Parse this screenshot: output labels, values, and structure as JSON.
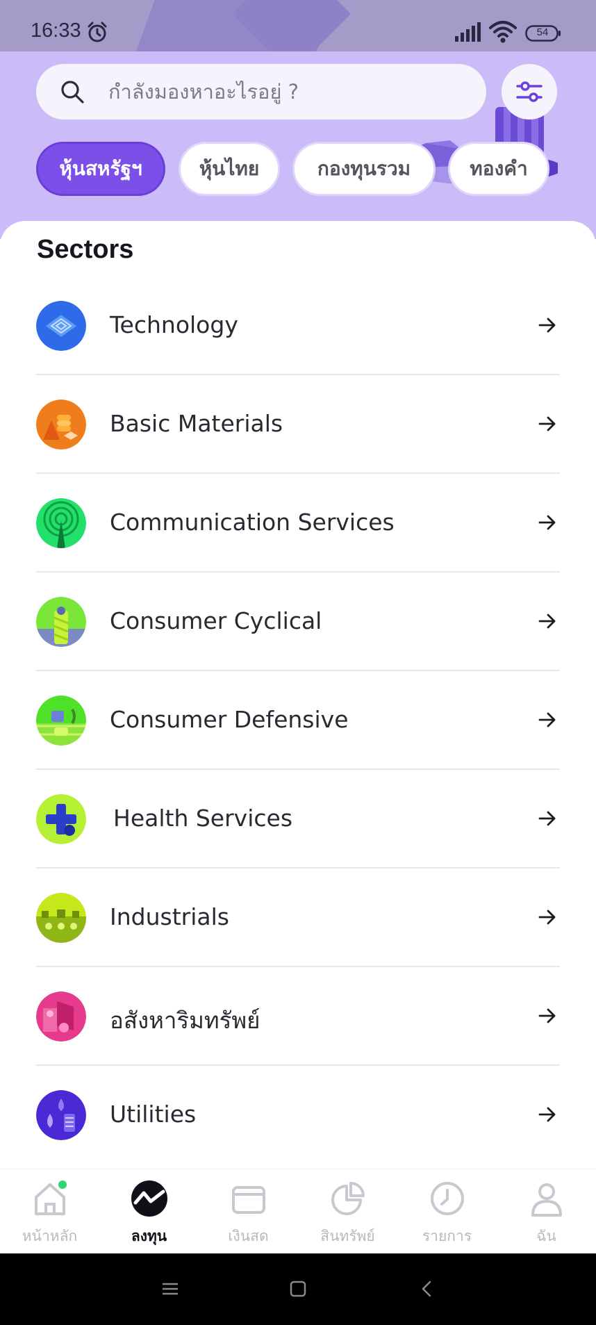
{
  "status_bar": {
    "time": "16:33",
    "battery": "54",
    "icons": [
      "alarm-icon",
      "signal-icon",
      "wifi-icon",
      "battery-icon"
    ]
  },
  "search": {
    "placeholder": "กำลังมองหาอะไรอยู่ ?",
    "icon": "search-icon",
    "filter_icon": "filter-sliders-icon"
  },
  "tabs": [
    {
      "label": "หุ้นสหรัฐฯ",
      "active": true
    },
    {
      "label": "หุ้นไทย",
      "active": false
    },
    {
      "label": "กองทุนรวม",
      "active": false
    },
    {
      "label": "ทองคำ",
      "active": false
    }
  ],
  "sectors": {
    "title": "Sectors",
    "items": [
      {
        "label": "Technology",
        "icon": "technology-icon"
      },
      {
        "label": "Basic Materials",
        "icon": "basic-materials-icon"
      },
      {
        "label": "Communication Services",
        "icon": "communication-tower-icon"
      },
      {
        "label": "Consumer Cyclical",
        "icon": "consumer-cyclical-icon"
      },
      {
        "label": "Consumer Defensive",
        "icon": "consumer-defensive-icon"
      },
      {
        "label": "Health Services",
        "icon": "health-cross-icon"
      },
      {
        "label": "Industrials",
        "icon": "industrials-icon"
      },
      {
        "label": "อสังหาริมทรัพย์",
        "icon": "real-estate-icon"
      },
      {
        "label": "Utilities",
        "icon": "utilities-icon"
      }
    ]
  },
  "bottom_nav": [
    {
      "label": "หน้าหลัก",
      "icon": "home-icon",
      "active": false
    },
    {
      "label": "ลงทุน",
      "icon": "invest-chart-icon",
      "active": true
    },
    {
      "label": "เงินสด",
      "icon": "wallet-icon",
      "active": false
    },
    {
      "label": "สินทรัพย์",
      "icon": "pie-chart-icon",
      "active": false
    },
    {
      "label": "รายการ",
      "icon": "history-clock-icon",
      "active": false
    },
    {
      "label": "ฉัน",
      "icon": "profile-icon",
      "active": false
    }
  ],
  "colors": {
    "accent": "#7b4fe8",
    "header_bg": "#cbbbf8",
    "status_bar_bg": "#a49bc8",
    "notification_dot": "#2ed573"
  }
}
